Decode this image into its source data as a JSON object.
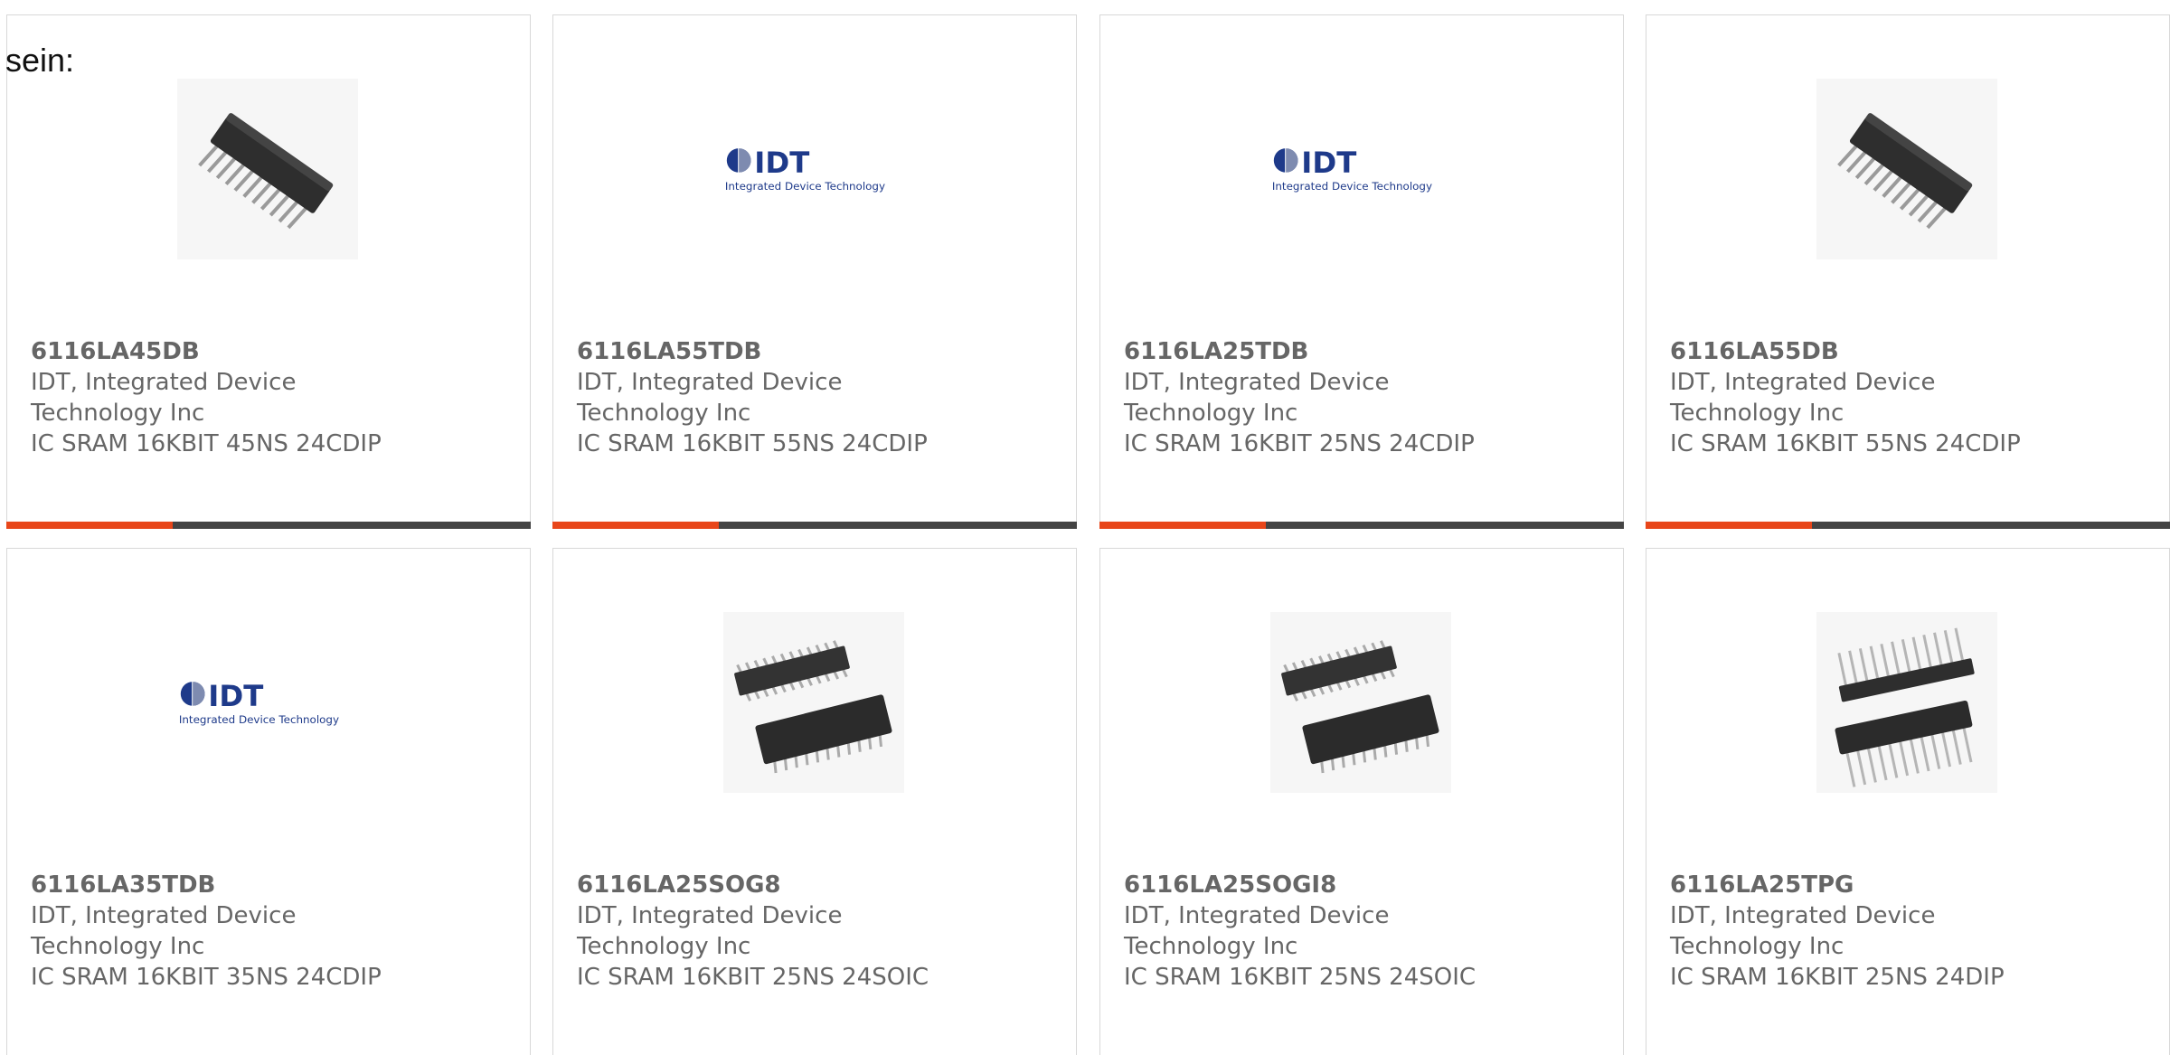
{
  "intro_text": "sein:",
  "colors": {
    "accent": "#e8461a",
    "bar": "#444444",
    "text": "#666666",
    "idt_blue": "#1e3a8a"
  },
  "logo": {
    "brand": "IDT",
    "tagline": "Integrated Device Technology"
  },
  "products": [
    {
      "part": "6116LA45DB",
      "manufacturer_line1": "IDT, Integrated Device",
      "manufacturer_line2": "Technology Inc",
      "description": "IC SRAM 16KBIT 45NS 24CDIP",
      "image": "dip-chip-icon"
    },
    {
      "part": "6116LA55TDB",
      "manufacturer_line1": "IDT, Integrated Device",
      "manufacturer_line2": "Technology Inc",
      "description": "IC SRAM 16KBIT 55NS 24CDIP",
      "image": "idt-logo"
    },
    {
      "part": "6116LA25TDB",
      "manufacturer_line1": "IDT, Integrated Device",
      "manufacturer_line2": "Technology Inc",
      "description": "IC SRAM 16KBIT 25NS 24CDIP",
      "image": "idt-logo"
    },
    {
      "part": "6116LA55DB",
      "manufacturer_line1": "IDT, Integrated Device",
      "manufacturer_line2": "Technology Inc",
      "description": "IC SRAM 16KBIT 55NS 24CDIP",
      "image": "dip-chip-icon"
    },
    {
      "part": "6116LA35TDB",
      "manufacturer_line1": "IDT, Integrated Device",
      "manufacturer_line2": "Technology Inc",
      "description": "IC SRAM 16KBIT 35NS 24CDIP",
      "image": "idt-logo"
    },
    {
      "part": "6116LA25SOG8",
      "manufacturer_line1": "IDT, Integrated Device",
      "manufacturer_line2": "Technology Inc",
      "description": "IC SRAM 16KBIT 25NS 24SOIC",
      "image": "soic-chip-icon"
    },
    {
      "part": "6116LA25SOGI8",
      "manufacturer_line1": "IDT, Integrated Device",
      "manufacturer_line2": "Technology Inc",
      "description": "IC SRAM 16KBIT 25NS 24SOIC",
      "image": "soic-chip-icon"
    },
    {
      "part": "6116LA25TPG",
      "manufacturer_line1": "IDT, Integrated Device",
      "manufacturer_line2": "Technology Inc",
      "description": "IC SRAM 16KBIT 25NS 24DIP",
      "image": "dip-pair-chip-icon"
    }
  ]
}
